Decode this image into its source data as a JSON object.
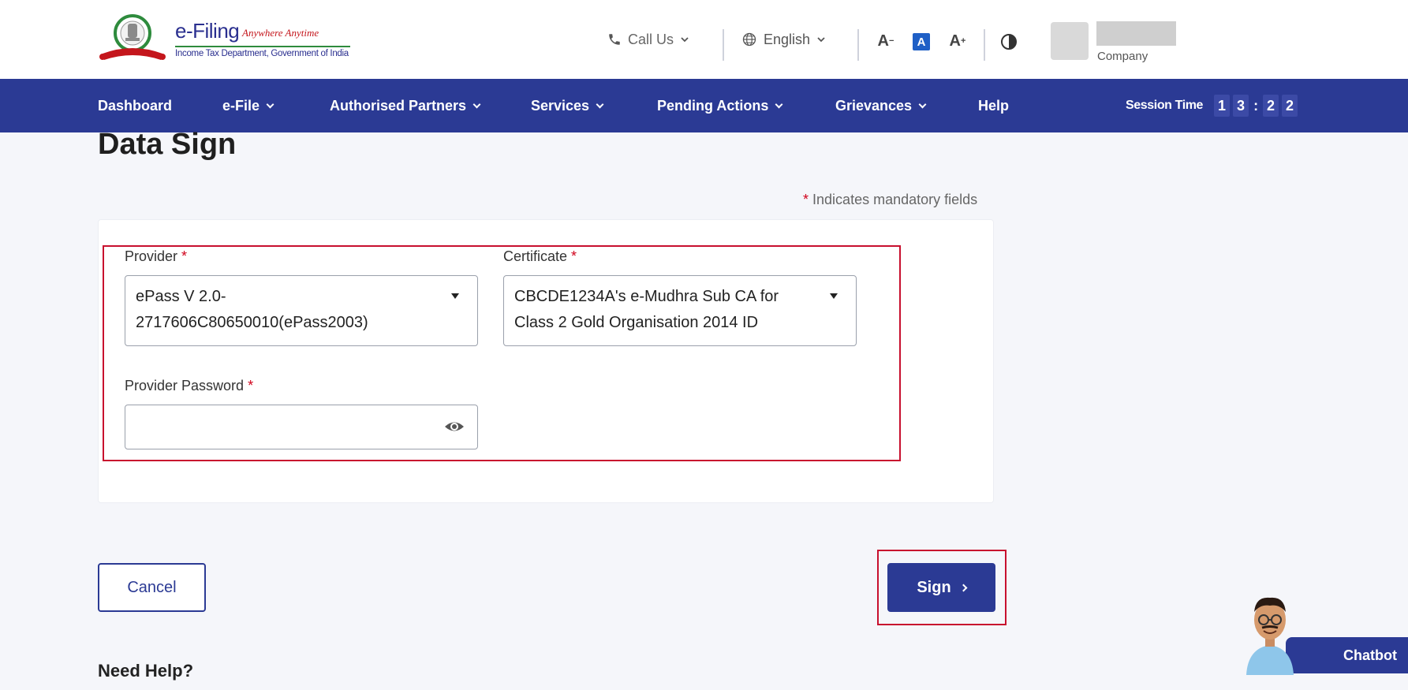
{
  "header": {
    "logo_title": "e-Filing",
    "logo_tagline": "Anywhere Anytime",
    "logo_subtitle": "Income Tax Department, Government of India",
    "call_us": "Call Us",
    "language": "English",
    "font_decrease": "A",
    "font_default": "A",
    "font_increase": "A",
    "user_role": "Company"
  },
  "nav": {
    "items": [
      {
        "label": "Dashboard"
      },
      {
        "label": "e-File"
      },
      {
        "label": "Authorised Partners"
      },
      {
        "label": "Services"
      },
      {
        "label": "Pending Actions"
      },
      {
        "label": "Grievances"
      },
      {
        "label": "Help"
      }
    ],
    "session_label": "Session Time",
    "session_digits": [
      "1",
      "3",
      "2",
      "2"
    ]
  },
  "page": {
    "title": "Data Sign",
    "mandatory_note": "Indicates mandatory fields",
    "star": "*"
  },
  "form": {
    "provider_label": "Provider",
    "provider_value_line1": "ePass V 2.0-",
    "provider_value_line2": "2717606C80650010(ePass2003)",
    "certificate_label": "Certificate",
    "certificate_value_line1": "CBCDE1234A's e-Mudhra Sub CA for",
    "certificate_value_line2": "Class 2 Gold Organisation 2014 ID",
    "password_label": "Provider Password",
    "password_value": ""
  },
  "buttons": {
    "cancel": "Cancel",
    "sign": "Sign"
  },
  "help": {
    "title": "Need Help?"
  },
  "chatbot": {
    "label": "Chatbot"
  },
  "colors": {
    "primary": "#2b3a94",
    "required": "#d0021b",
    "highlight": "#c8102e"
  }
}
